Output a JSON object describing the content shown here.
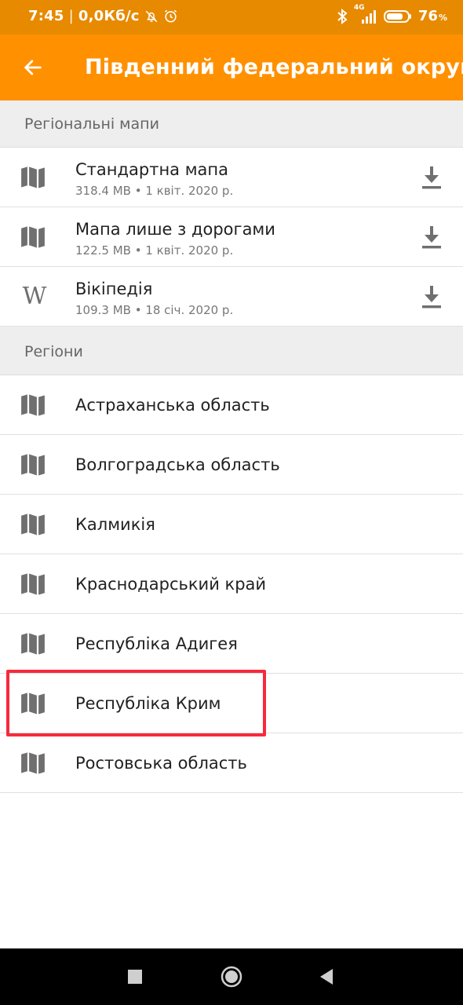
{
  "status_bar": {
    "time": "7:45",
    "network_speed": "0,0Кб/с",
    "separator": "|",
    "network_type": "4G",
    "battery_percent": "76",
    "battery_unit": "%"
  },
  "app_bar": {
    "title": "Південний федеральний округ"
  },
  "sections": {
    "regional_maps": {
      "header": "Регіональні мапи",
      "items": [
        {
          "title": "Стандартна мапа",
          "subtitle": "318.4 MB • 1 квіт. 2020 р."
        },
        {
          "title": "Мапа лише з дорогами",
          "subtitle": "122.5 MB • 1 квіт. 2020 р."
        },
        {
          "title": "Вікіпедія",
          "subtitle": "109.3 MB • 18 січ. 2020 р."
        }
      ]
    },
    "regions": {
      "header": "Регіони",
      "items": [
        {
          "title": "Астраханська область"
        },
        {
          "title": "Волгоградська область"
        },
        {
          "title": "Калмикія"
        },
        {
          "title": "Краснодарський край"
        },
        {
          "title": "Республіка Адигея"
        },
        {
          "title": "Республіка Крим"
        },
        {
          "title": "Ростовська область"
        }
      ]
    }
  },
  "icons": {
    "back": "arrow-left-icon",
    "map": "map-icon",
    "wikipedia": "wikipedia-icon",
    "download": "download-icon"
  },
  "wiki_glyph": "W",
  "colors": {
    "status_bar": "#e78a00",
    "app_bar": "#ff9000",
    "highlight": "#f8293b",
    "icon_gray": "#6f6f6f"
  }
}
